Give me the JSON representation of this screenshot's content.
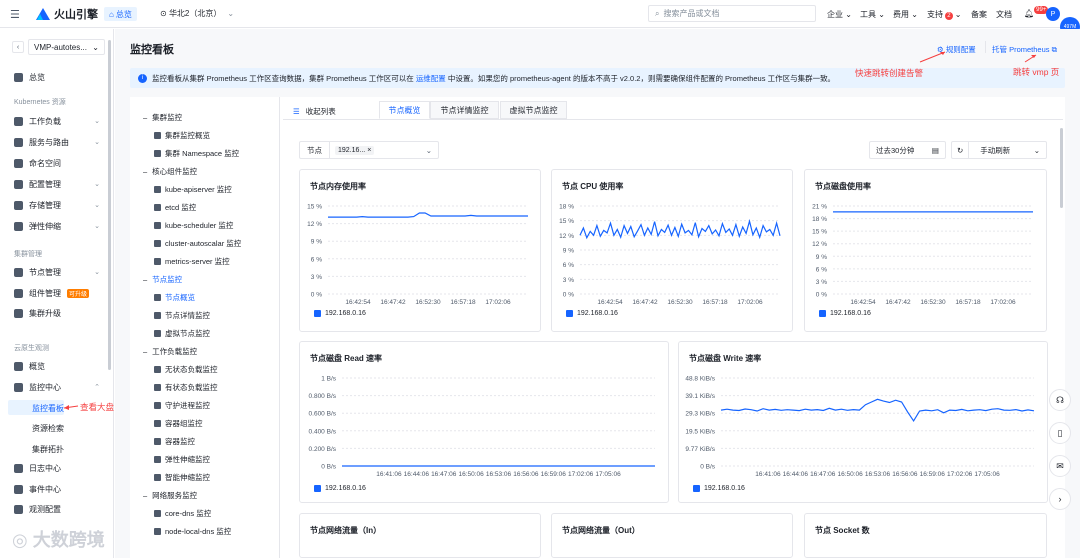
{
  "topbar": {
    "brand": "火山引擎",
    "home": "总览",
    "region": "华北2（北京）",
    "search_placeholder": "搜索产品或文档",
    "nav": [
      "企业",
      "工具",
      "费用",
      "支持",
      "备案",
      "文档"
    ],
    "support_badge": "2",
    "bell_badge": "99+",
    "avatar": "P",
    "avatar2": "497M"
  },
  "sidebar": {
    "project": "VMP-autotes...",
    "overview": "总览",
    "sec_k8s": "Kubernetes 资源",
    "workload": "工作负载",
    "service": "服务与路由",
    "namespace": "命名空间",
    "config": "配置管理",
    "storage": "存储管理",
    "elastic": "弹性伸缩",
    "sec_cluster": "集群管理",
    "node": "节点管理",
    "component": "组件管理",
    "upgrade_badge": "可升级",
    "cluster_upgrade": "集群升级",
    "sec_cloud": "云原生观测",
    "cloud_overview": "概览",
    "monitor": "监控中心",
    "monitor_board": "监控看板",
    "resource_check": "资源检索",
    "topology": "集群拓扑",
    "log": "日志中心",
    "event": "事件中心",
    "obs_config": "观测配置"
  },
  "page": {
    "title": "监控看板",
    "rule_link": "规则配置",
    "prom_link": "托管 Prometheus",
    "info_pre": "监控看板从集群 Prometheus 工作区查询数据，集群 Prometheus 工作区可以在",
    "info_link": "运维配置",
    "info_post": "中设置。如果您的 prometheus-agent 的版本不高于 v2.0.2，则需要确保组件配置的 Prometheus 工作区与集群一致。"
  },
  "annotations": {
    "alert": "快速跳转创建告警",
    "vmp": "跳转 vmp 页",
    "board": "查看大盘"
  },
  "tree": {
    "collapse": "收起列表",
    "groups": [
      {
        "label": "集群监控",
        "items": [
          "集群监控概览",
          "集群 Namespace 监控"
        ]
      },
      {
        "label": "核心组件监控",
        "items": [
          "kube-apiserver 监控",
          "etcd 监控",
          "kube-scheduler 监控",
          "cluster-autoscalar 监控",
          "metrics-server 监控"
        ]
      },
      {
        "label": "节点监控",
        "items": [
          "节点概览",
          "节点详情监控",
          "虚拟节点监控"
        ]
      },
      {
        "label": "工作负载监控",
        "items": [
          "无状态负载监控",
          "有状态负载监控",
          "守护进程监控",
          "容器组监控",
          "容器监控",
          "弹性伸缩监控",
          "智能伸缩监控"
        ]
      },
      {
        "label": "网络服务监控",
        "items": [
          "core-dns 监控",
          "node-local-dns 监控"
        ]
      }
    ]
  },
  "tabs": [
    "节点概览",
    "节点详情监控",
    "虚拟节点监控"
  ],
  "filters": {
    "node_label": "节点",
    "node_value": "192.16...",
    "time": "过去30分钟",
    "refresh": "手动刷新"
  },
  "legend_ip": "192.168.0.16",
  "watermark": "大数跨境",
  "chart_data": [
    {
      "type": "line",
      "title": "节点内存使用率",
      "ylabels": [
        "15 %",
        "12 %",
        "9 %",
        "6 %",
        "3 %",
        "0 %"
      ],
      "ylim": [
        0,
        15
      ],
      "x": [
        "16:42:54",
        "16:47:42",
        "16:52:30",
        "16:57:18",
        "17:02:06"
      ],
      "series": [
        {
          "name": "192.168.0.16",
          "values": [
            13.1,
            13.1,
            13.1,
            13.1,
            13.1,
            13.1,
            13.2,
            13.1,
            13.1,
            13.1,
            13.1,
            13.1,
            13.1,
            13.1,
            13.1,
            13.2,
            13.8,
            13.8,
            13.3,
            13.3,
            13.3,
            13.3,
            13.3,
            13.3,
            13.3,
            13.4,
            13.3,
            13.3,
            13.3,
            13.3,
            13.3,
            13.3,
            13.3,
            13.3,
            13.3,
            13.3
          ]
        }
      ]
    },
    {
      "type": "line",
      "title": "节点 CPU 使用率",
      "ylabels": [
        "18 %",
        "15 %",
        "12 %",
        "9 %",
        "6 %",
        "3 %",
        "0 %"
      ],
      "ylim": [
        0,
        18
      ],
      "x": [
        "16:42:54",
        "16:47:42",
        "16:52:30",
        "16:57:18",
        "17:02:06"
      ],
      "series": [
        {
          "name": "192.168.0.16",
          "values": [
            12,
            13.5,
            11.5,
            12.8,
            12,
            14,
            11.8,
            13,
            12.5,
            14.5,
            12,
            13.2,
            11.6,
            14,
            12.4,
            13.8,
            11.7,
            12.9,
            14.2,
            12,
            13.5,
            12.2,
            14.8,
            11.9,
            13.2,
            12.6,
            14.1,
            12,
            13.6,
            11.8,
            14.3,
            12.5,
            13,
            12.1,
            14.6,
            11.7,
            13.4,
            12.8,
            14,
            12.3,
            13.1,
            11.9,
            14.4,
            12.6,
            13.3,
            12,
            14.2,
            11.8,
            13.7,
            12.4,
            14.9,
            12.1,
            13.5,
            11.6,
            14,
            12.7,
            13.2,
            12,
            14.5,
            11.9
          ]
        }
      ]
    },
    {
      "type": "line",
      "title": "节点磁盘使用率",
      "ylabels": [
        "21 %",
        "18 %",
        "15 %",
        "12 %",
        "9 %",
        "6 %",
        "3 %",
        "0 %"
      ],
      "ylim": [
        0,
        21
      ],
      "x": [
        "16:42:54",
        "16:47:42",
        "16:52:30",
        "16:57:18",
        "17:02:06"
      ],
      "series": [
        {
          "name": "192.168.0.16",
          "values": [
            19.6,
            19.6,
            19.6,
            19.6,
            19.6,
            19.6,
            19.6,
            19.6,
            19.6,
            19.6
          ]
        }
      ]
    },
    {
      "type": "line",
      "title": "节点磁盘 Read 速率",
      "ylabels": [
        "1 B/s",
        "0.800 B/s",
        "0.600 B/s",
        "0.400 B/s",
        "0.200 B/s",
        "0 B/s"
      ],
      "ylim": [
        0,
        1
      ],
      "x": [
        "16:41:06",
        "16:44:06",
        "16:47:06",
        "16:50:06",
        "16:53:06",
        "16:56:06",
        "16:59:06",
        "17:02:06",
        "17:05:06"
      ],
      "series": [
        {
          "name": "192.168.0.16",
          "values": [
            0,
            0,
            0,
            0,
            0,
            0,
            0,
            0,
            0,
            0
          ]
        }
      ]
    },
    {
      "type": "line",
      "title": "节点磁盘 Write 速率",
      "ylabels": [
        "48.8 KiB/s",
        "39.1 KiB/s",
        "29.3 KiB/s",
        "19.5 KiB/s",
        "9.77 KiB/s",
        "0 B/s"
      ],
      "ylim": [
        0,
        48.8
      ],
      "x": [
        "16:41:06",
        "16:44:06",
        "16:47:06",
        "16:50:06",
        "16:53:06",
        "16:56:06",
        "16:59:06",
        "17:02:06",
        "17:05:06"
      ],
      "series": [
        {
          "name": "192.168.0.16",
          "values": [
            31,
            31.5,
            31,
            30.8,
            31.6,
            31.2,
            30.5,
            31.8,
            31,
            31.4,
            30.9,
            31.2,
            31,
            30.7,
            31.5,
            31,
            31.3,
            30.8,
            32,
            31,
            31.5,
            30.9,
            31.3,
            31,
            34,
            35.5,
            37,
            36,
            35.2,
            36.5,
            35.5,
            30,
            25,
            30.5,
            31,
            30.6,
            31.2,
            29.5,
            31,
            30.8,
            31.4,
            30.6,
            31,
            31.2,
            30.7,
            31.5,
            31.8,
            31,
            30.9,
            31.3,
            30.5,
            31.1,
            30.6
          ]
        }
      ]
    },
    {
      "type": "line",
      "title": "节点网络流量（In）"
    },
    {
      "type": "line",
      "title": "节点网络流量（Out）"
    },
    {
      "type": "line",
      "title": "节点 Socket 数"
    }
  ]
}
